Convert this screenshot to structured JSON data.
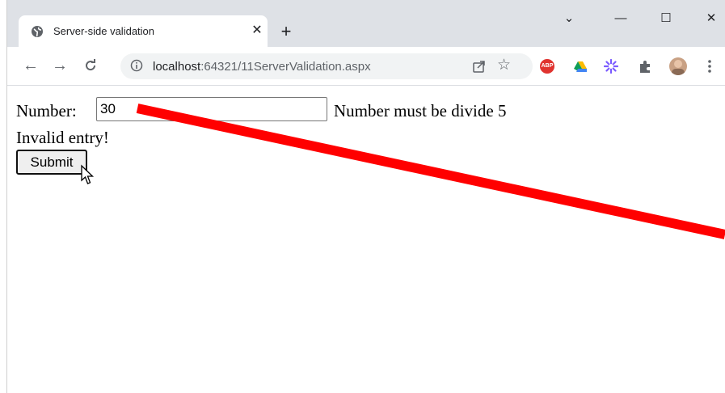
{
  "browser": {
    "tab_title": "Server-side validation",
    "tab_close": "✕",
    "new_tab": "+",
    "url_host": "localhost",
    "url_rest": ":64321/11ServerValidation.aspx",
    "window_controls": {
      "dropdown": "⌄",
      "minimize": "—",
      "maximize": "☐",
      "close": "✕"
    },
    "extensions": [
      "abp-icon",
      "google-drive-icon",
      "sparkle-extension-icon",
      "puzzle-extensions-icon"
    ],
    "abp_label": "ABP"
  },
  "form": {
    "number_label": "Number:",
    "number_value": "30",
    "validator_message": "Number must be divide 5",
    "error_message": "Invalid entry!",
    "submit_label": "Submit"
  },
  "colors": {
    "annotation_line": "#ff0000",
    "titlebar": "#dee1e6"
  }
}
